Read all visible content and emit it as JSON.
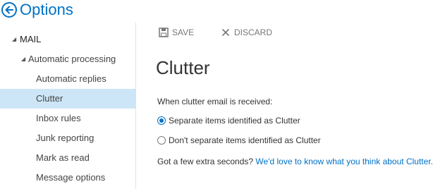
{
  "header": {
    "title": "Options"
  },
  "sidebar": {
    "section": "MAIL",
    "group": "Automatic processing",
    "items": [
      {
        "label": "Automatic replies",
        "selected": false
      },
      {
        "label": "Clutter",
        "selected": true
      },
      {
        "label": "Inbox rules",
        "selected": false
      },
      {
        "label": "Junk reporting",
        "selected": false
      },
      {
        "label": "Mark as read",
        "selected": false
      },
      {
        "label": "Message options",
        "selected": false
      }
    ]
  },
  "toolbar": {
    "save_label": "SAVE",
    "discard_label": "DISCARD"
  },
  "main": {
    "title": "Clutter",
    "question": "When clutter email is received:",
    "options": [
      {
        "label": "Separate items identified as Clutter",
        "checked": true
      },
      {
        "label": "Don't separate items identified as Clutter",
        "checked": false
      }
    ],
    "feedback_text": "Got a few extra seconds?",
    "feedback_link": "We'd love to know what you think about Clutter."
  },
  "colors": {
    "accent": "#0072c6",
    "selected_bg": "#cde6f7"
  }
}
